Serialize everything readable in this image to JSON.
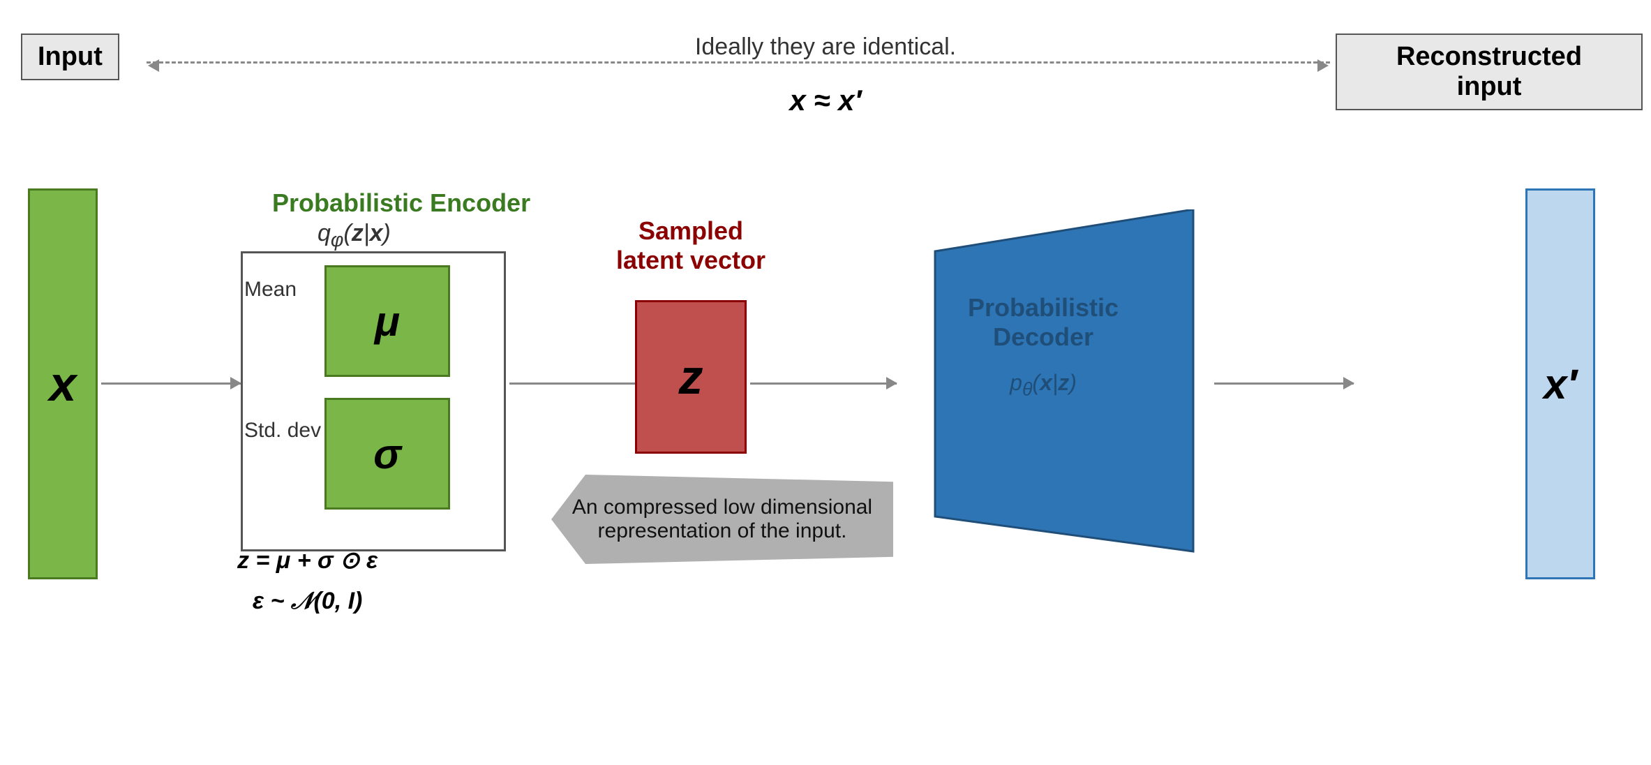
{
  "diagram": {
    "background": "#ffffff",
    "top": {
      "input_label": "Input",
      "reconstructed_label": "Reconstructed\ninput",
      "center_text": "Ideally they are identical.",
      "equation": "x ≈ x′"
    },
    "x_input": {
      "label": "x"
    },
    "encoder": {
      "title": "Probabilistic Encoder",
      "formula": "qφ(z|x)",
      "mean_label": "Mean",
      "stddev_label": "Std. dev",
      "mu_label": "μ",
      "sigma_label": "σ"
    },
    "encoder_equations": {
      "line1": "z = μ + σ ⊙ ε",
      "line2": "ε ~ 𝒩(0, I)"
    },
    "z_vector": {
      "title": "Sampled\nlatent vector",
      "label": "z"
    },
    "compressed_callout": "An compressed low dimensional\nrepresentation of the input.",
    "decoder": {
      "title": "Probabilistic\nDecoder",
      "formula": "pθ(x|z)"
    },
    "xprime": {
      "label": "x′"
    }
  }
}
